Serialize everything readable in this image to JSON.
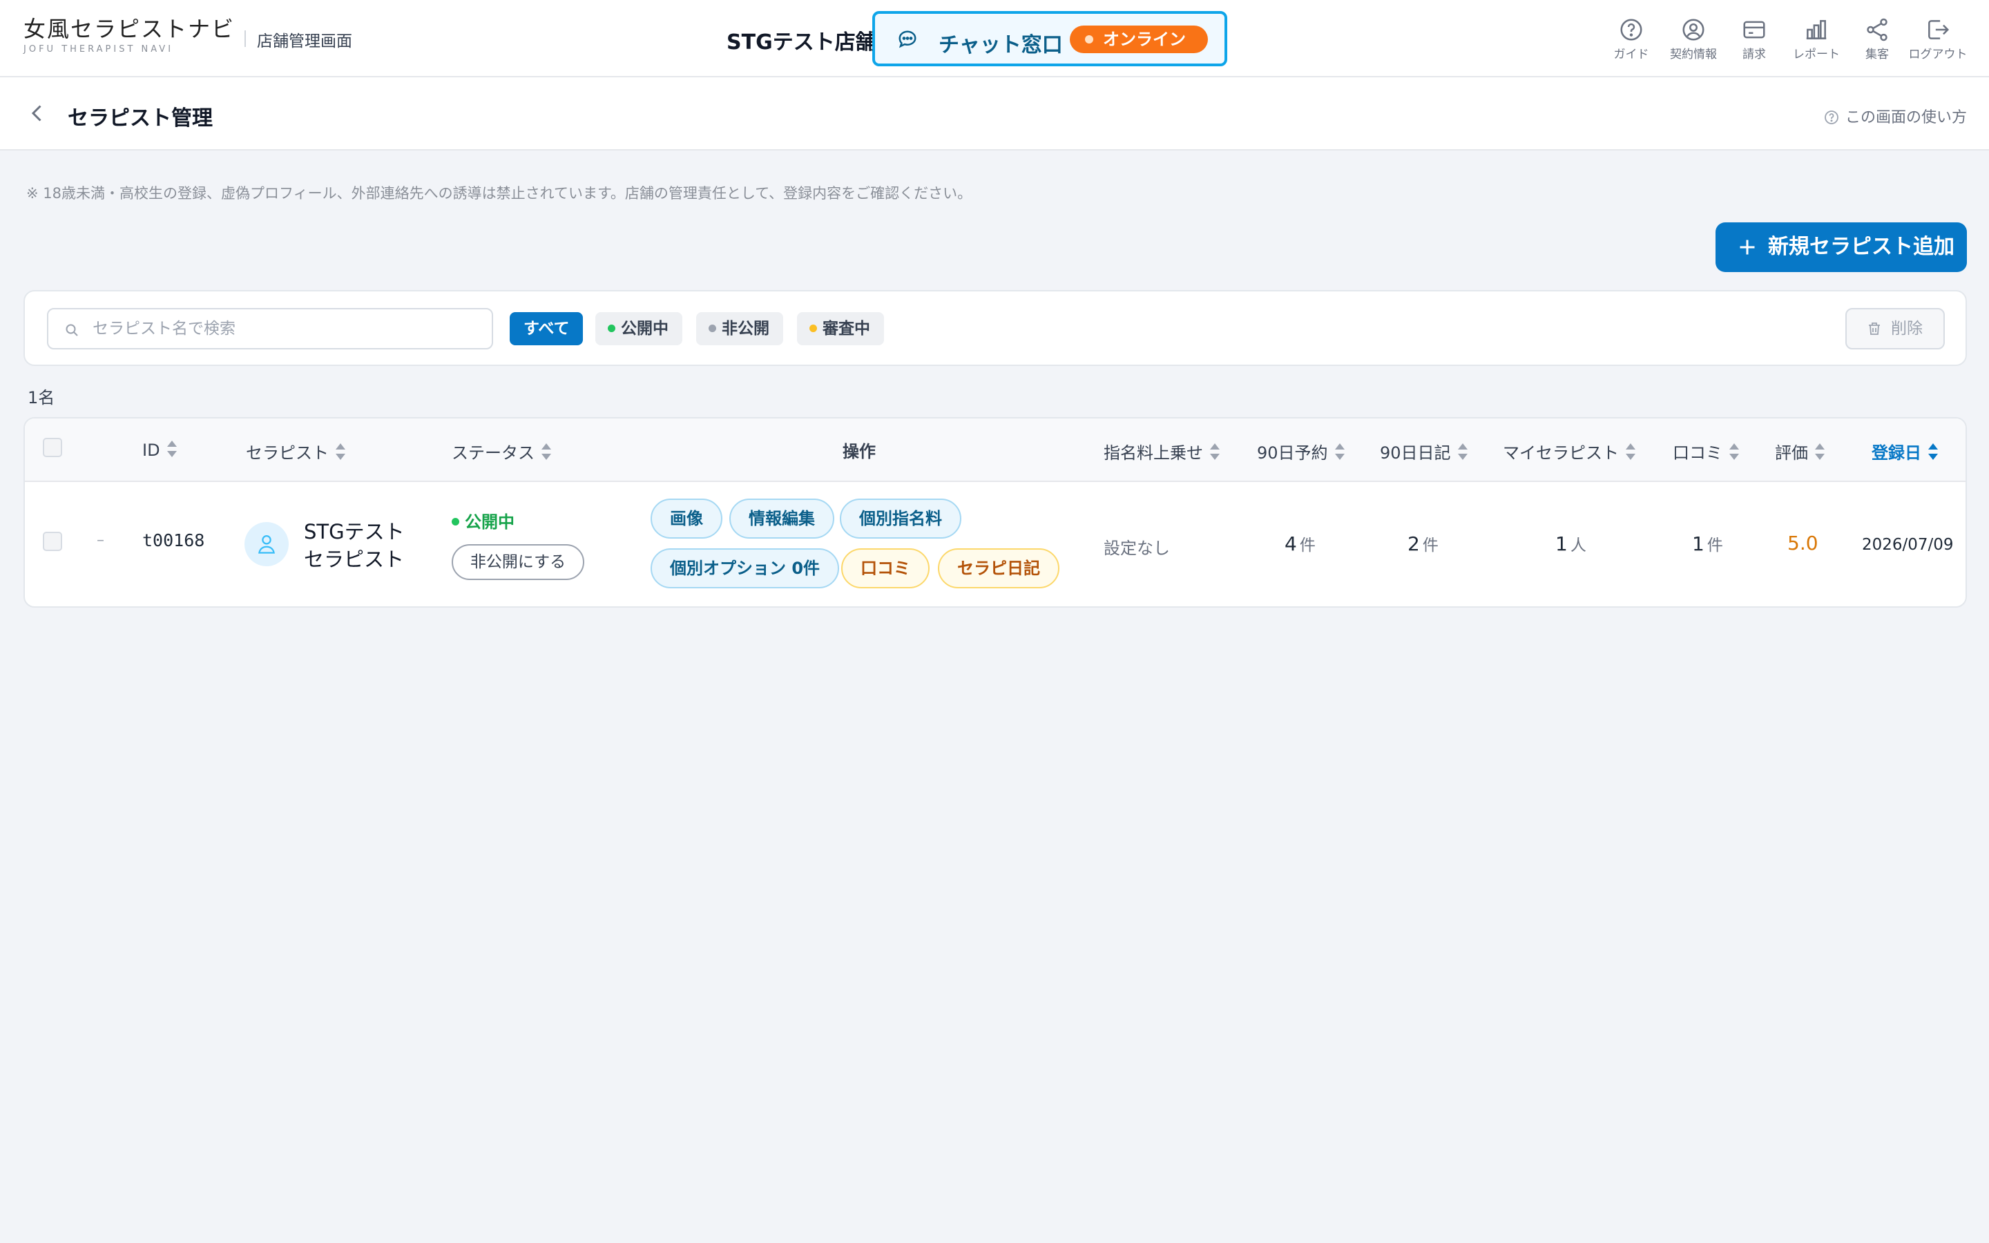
{
  "header": {
    "logo_main": "女風セラピストナビ",
    "logo_sub": "JOFU THERAPIST NAVI",
    "section": "店舗管理画面",
    "store_name": "STGテスト店舗",
    "chat_label": "チャット窓口",
    "chat_status": "オンライン",
    "nav": [
      {
        "label": "ガイド",
        "icon": "help-circle-icon"
      },
      {
        "label": "契約情報",
        "icon": "user-circle-icon"
      },
      {
        "label": "請求",
        "icon": "credit-card-icon"
      },
      {
        "label": "レポート",
        "icon": "bar-chart-icon"
      },
      {
        "label": "集客",
        "icon": "share-icon"
      },
      {
        "label": "ログアウト",
        "icon": "logout-icon"
      }
    ]
  },
  "page": {
    "title": "セラピスト管理",
    "help": "この画面の使い方",
    "notice": "※ 18歳未満・高校生の登録、虚偽プロフィール、外部連絡先への誘導は禁止されています。店舗の管理責任として、登録内容をご確認ください。",
    "add_button": "新規セラピスト追加"
  },
  "filters": {
    "search_placeholder": "セラピスト名で検索",
    "search_value": "",
    "chips": [
      {
        "label": "すべて",
        "active": true,
        "dot_color": ""
      },
      {
        "label": "公開中",
        "active": false,
        "dot_color": "#22c55e"
      },
      {
        "label": "非公開",
        "active": false,
        "dot_color": "#9ca3af"
      },
      {
        "label": "審査中",
        "active": false,
        "dot_color": "#fbbf24"
      }
    ],
    "delete_label": "削除"
  },
  "table": {
    "count": "1名",
    "columns": [
      "ID",
      "セラピスト",
      "ステータス",
      "操作",
      "指名料上乗せ",
      "90日予約",
      "90日日記",
      "マイセラピスト",
      "口コミ",
      "評価",
      "登録日"
    ],
    "sorted_column": "登録日",
    "rows": [
      {
        "expand": "–",
        "id": "t00168",
        "name_line1": "STGテスト",
        "name_line2": "セラピスト",
        "status": "公開中",
        "status_color": "#16a34a",
        "toggle_label": "非公開にする",
        "actions_row1": [
          "画像",
          "情報編集",
          "個別指名料"
        ],
        "actions_row2_blue": "個別オプション 0件",
        "actions_row2_yellow": [
          "口コミ",
          "セラピ日記"
        ],
        "fee": "設定なし",
        "reservations_num": "4",
        "reservations_unit": "件",
        "diary_num": "2",
        "diary_unit": "件",
        "my_therapist_num": "1",
        "my_therapist_unit": "人",
        "reviews_num": "1",
        "reviews_unit": "件",
        "rating": "5.0",
        "rating_color": "#d97706",
        "registered": "2026/07/09"
      }
    ]
  },
  "colors": {
    "primary": "#0778c7",
    "online": "#f97316",
    "chat_border": "#0ea5e9"
  }
}
